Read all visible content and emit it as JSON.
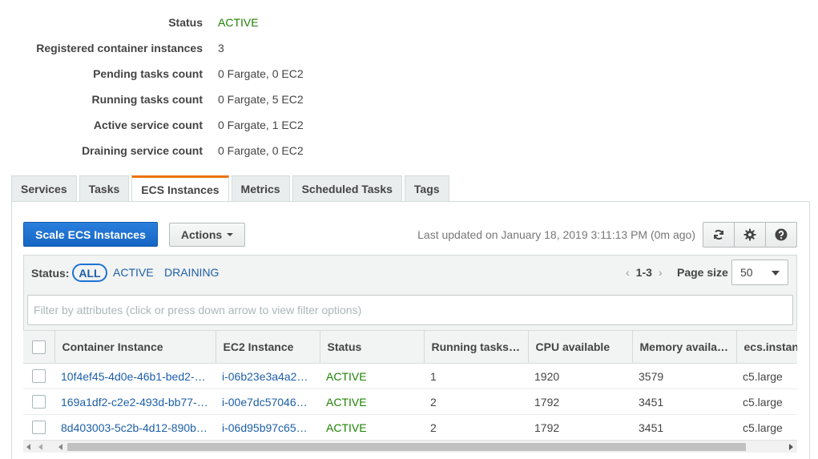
{
  "summary": {
    "rows": [
      {
        "label": "Status",
        "value": "ACTIVE"
      },
      {
        "label": "Registered container instances",
        "value": "3"
      },
      {
        "label": "Pending tasks count",
        "value": "0 Fargate, 0 EC2"
      },
      {
        "label": "Running tasks count",
        "value": "0 Fargate, 5 EC2"
      },
      {
        "label": "Active service count",
        "value": "0 Fargate, 1 EC2"
      },
      {
        "label": "Draining service count",
        "value": "0 Fargate, 0 EC2"
      }
    ]
  },
  "tabs": [
    {
      "label": "Services"
    },
    {
      "label": "Tasks"
    },
    {
      "label": "ECS Instances",
      "active": true
    },
    {
      "label": "Metrics"
    },
    {
      "label": "Scheduled Tasks"
    },
    {
      "label": "Tags"
    }
  ],
  "toolbar": {
    "scale_label": "Scale ECS Instances",
    "actions_label": "Actions",
    "last_updated": "Last updated on January 18, 2019 3:11:13 PM (0m ago)",
    "icons": [
      "refresh-icon",
      "gear-icon",
      "help-icon"
    ]
  },
  "filter": {
    "status_label": "Status:",
    "options": [
      "ALL",
      "ACTIVE",
      "DRAINING"
    ],
    "selected": "ALL",
    "pager_range": "1-3",
    "page_size_label": "Page size",
    "page_size_value": "50",
    "placeholder": "Filter by attributes (click or press down arrow to view filter options)"
  },
  "table": {
    "columns": [
      "Container Instance",
      "EC2 Instance",
      "Status",
      "Running tasks…",
      "CPU available",
      "Memory availa…",
      "ecs.instance-type"
    ],
    "rows": [
      [
        "10f4ef45-4d0e-46b1-bed2-…",
        "i-06b23e3a4a2…",
        "ACTIVE",
        "1",
        "1920",
        "3579",
        "c5.large"
      ],
      [
        "169a1df2-c2e2-493d-bb77-…",
        "i-00e7dc57046…",
        "ACTIVE",
        "2",
        "1792",
        "3451",
        "c5.large"
      ],
      [
        "8d403003-5c2b-4d12-890b…",
        "i-06d95b97c65…",
        "ACTIVE",
        "2",
        "1792",
        "3451",
        "c5.large"
      ]
    ]
  },
  "colors": {
    "active_green": "#1d8102",
    "link_blue": "#1d5fa8",
    "primary_button": "#1d73d3",
    "tab_accent": "#ec7211"
  }
}
